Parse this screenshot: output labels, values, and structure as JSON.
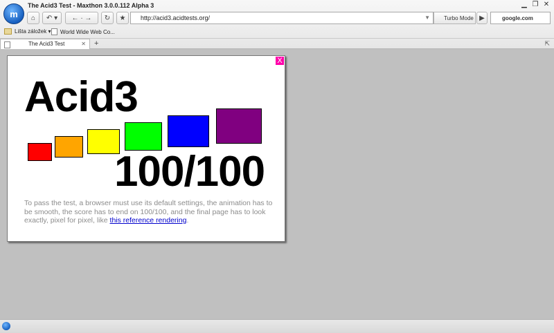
{
  "window": {
    "title": "The Acid3 Test - Maxthon 3.0.0.112 Alpha 3"
  },
  "toolbar": {
    "url": "http://acid3.acidtests.org/",
    "turbo_label": "Turbo Mode",
    "search_value": "google.com"
  },
  "bookmarks": [
    {
      "label": "Lišta záložek ▾"
    },
    {
      "label": "World Wide Web Co..."
    }
  ],
  "tabs": [
    {
      "label": "The Acid3 Test"
    }
  ],
  "page": {
    "close_label": "X",
    "heading": "Acid3",
    "score": "100/100",
    "info_text": "To pass the test, a browser must use its default settings, the animation has to be smooth, the score has to end on 100/100, and the final page has to look exactly, pixel for pixel, like ",
    "link_text": "this reference rendering",
    "info_end": ".",
    "box_colors": [
      "#ff0000",
      "#ffa500",
      "#ffff00",
      "#00ff00",
      "#0000ff",
      "#800080"
    ]
  }
}
